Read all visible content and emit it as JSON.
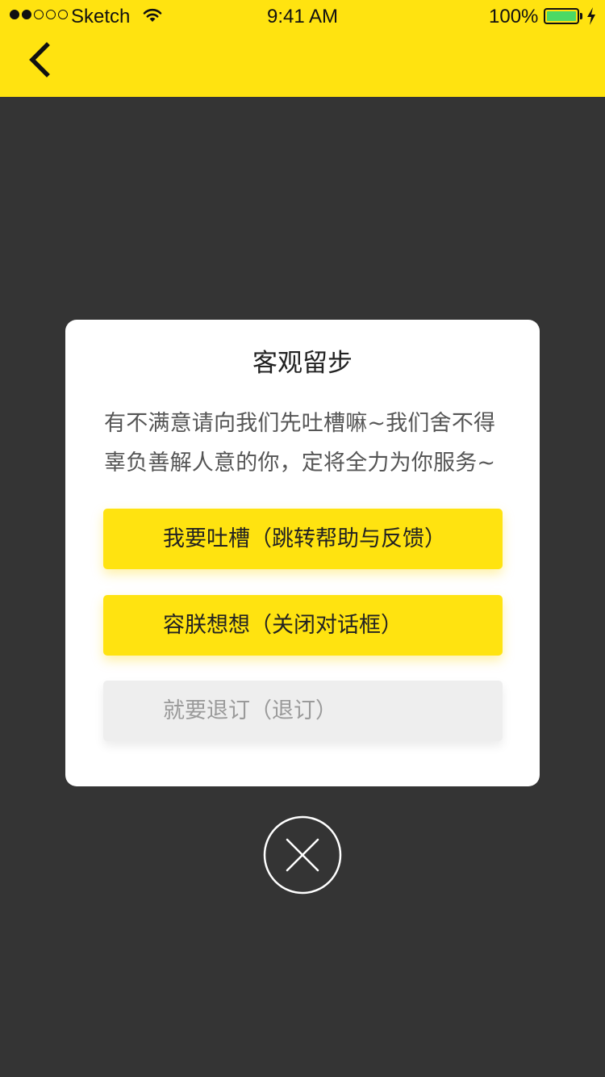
{
  "status_bar": {
    "carrier": "Sketch",
    "time": "9:41 AM",
    "battery_percent": "100%",
    "signal_strength_filled": 2,
    "signal_strength_total": 5,
    "battery_color": "#4CD964"
  },
  "nav": {
    "back_icon": "chevron-left-icon",
    "background_color": "#FFE310"
  },
  "dialog": {
    "title": "客观留步",
    "message_line1": "有不满意请向我们先吐槽嘛~我们舍不得",
    "message_line2": "辜负善解人意的你，定将全力为你服务~",
    "buttons": [
      {
        "label": "我要吐槽（跳转帮助与反馈）",
        "style": "primary",
        "color": "#FFE310"
      },
      {
        "label": "容朕想想（关闭对话框）",
        "style": "primary",
        "color": "#FFE310"
      },
      {
        "label": "就要退订（退订）",
        "style": "secondary",
        "color": "#EEEEEE"
      }
    ]
  },
  "close_icon": "close-circle-icon",
  "overlay_color": "#343434"
}
